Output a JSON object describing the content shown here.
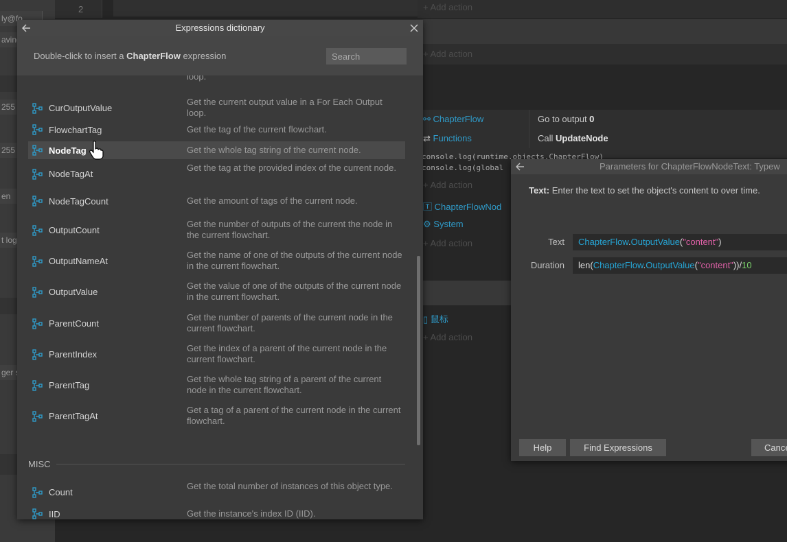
{
  "left_panel": {
    "rows": [
      "ly@fo",
      "aving",
      "255",
      "255",
      "en",
      "t log",
      "ger s"
    ]
  },
  "event_sheet": {
    "line_number": "2",
    "add_action": "Add action",
    "rows": [
      {
        "object": "ChapterFlow",
        "action": "Go to output ",
        "param": "0"
      },
      {
        "object": "Functions",
        "action": "Call ",
        "param": "UpdateNode"
      }
    ],
    "code_lines": [
      "console.log(runtime.objects.ChapterFlow)",
      "console.log(global"
    ],
    "rows2": [
      {
        "object": "ChapterFlowNod"
      },
      {
        "object": "System"
      }
    ],
    "mouse_object": "鼠标"
  },
  "dictionary": {
    "title": "Expressions dictionary",
    "hint_prefix": "Double-click to insert a ",
    "hint_object": "ChapterFlow",
    "hint_suffix": " expression",
    "search_placeholder": "Search",
    "partial_desc": "loop.",
    "items": [
      {
        "name": "CurOutputValue",
        "desc": "Get the current output value in a For Each Output loop."
      },
      {
        "name": "FlowchartTag",
        "desc": "Get the tag of the current flowchart."
      },
      {
        "name": "NodeTag",
        "desc": "Get the whole tag string of the current node."
      },
      {
        "name": "NodeTagAt",
        "desc": "Get the tag at the provided index of the current node."
      },
      {
        "name": "NodeTagCount",
        "desc": "Get the amount of tags of the current node."
      },
      {
        "name": "OutputCount",
        "desc": "Get the number of outputs of the current the node in the current flowchart."
      },
      {
        "name": "OutputNameAt",
        "desc": "Get the name of one of the outputs of the current node in the current flowchart."
      },
      {
        "name": "OutputValue",
        "desc": "Get the value of one of the outputs of the current node in the current flowchart."
      },
      {
        "name": "ParentCount",
        "desc": "Get the number of parents of the current node in the current flowchart."
      },
      {
        "name": "ParentIndex",
        "desc": "Get the index of a parent of the current node in the current flowchart."
      },
      {
        "name": "ParentTag",
        "desc": "Get the whole tag string of a parent of the current node in the current flowchart."
      },
      {
        "name": "ParentTagAt",
        "desc": "Get a tag of a parent of the current node in the current flowchart."
      }
    ],
    "section_misc": "MISC",
    "misc_items": [
      {
        "name": "Count",
        "desc": "Get the total number of instances of this object type."
      },
      {
        "name": "IID",
        "desc": "Get the instance's index ID (IID)."
      }
    ]
  },
  "parameters": {
    "title": "Parameters for ChapterFlowNodeText: Typew",
    "desc_label": "Text:",
    "desc_text": " Enter the text to set the object's content to over time.",
    "text_label": "Text",
    "text_tokens": {
      "obj": "ChapterFlow",
      "dot": ".",
      "fn": "OutputValue",
      "open": "(",
      "str": "\"content\"",
      "close": ")"
    },
    "duration_label": "Duration",
    "duration_tokens": {
      "pre": "len(",
      "obj": "ChapterFlow",
      "dot": ".",
      "fn": "OutputValue",
      "open": "(",
      "str": "\"content\"",
      "close": "))/",
      "num": "10"
    },
    "help_button": "Help",
    "find_button": "Find Expressions",
    "cancel_button": "Cance"
  },
  "colors": {
    "accent": "#2f9bc9",
    "string": "#e061a8",
    "number": "#7bd26c"
  }
}
